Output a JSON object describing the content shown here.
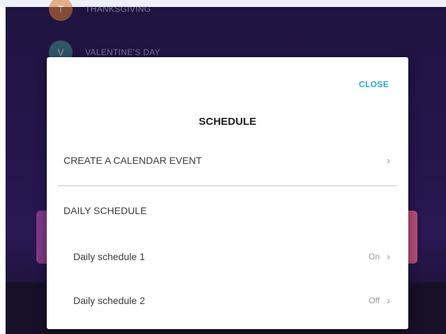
{
  "background": {
    "list": [
      {
        "label": "THANKSGIVING",
        "initial": "T",
        "color": "#d77a2f"
      },
      {
        "label": "VALENTINE'S DAY",
        "initial": "V",
        "color": "#3e8f86"
      }
    ]
  },
  "dialog": {
    "close_label": "CLOSE",
    "title": "SCHEDULE",
    "create_event": {
      "label": "CREATE A CALENDAR EVENT",
      "chevron_icon": "chevron-right-icon"
    },
    "section_label": "DAILY SCHEDULE",
    "schedules": [
      {
        "label": "Daily schedule 1",
        "status": "On",
        "chevron_icon": "chevron-right-icon"
      },
      {
        "label": "Daily schedule 2",
        "status": "Off",
        "chevron_icon": "chevron-right-icon"
      }
    ]
  },
  "colors": {
    "accent": "#29a3dc",
    "background": "#1f1440",
    "card_gradient_start": "#8a3e8e",
    "card_gradient_end": "#c4587e"
  }
}
